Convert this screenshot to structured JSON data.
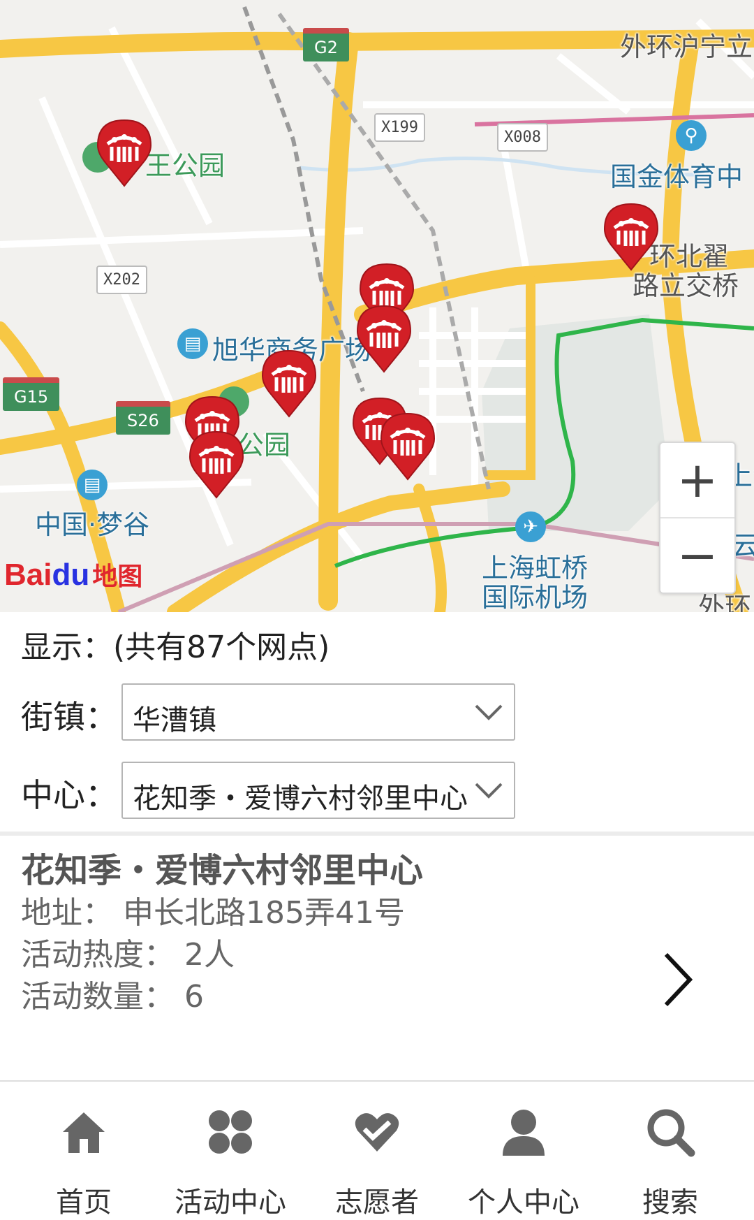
{
  "map": {
    "road_tags": {
      "g2": "G2",
      "x199": "X199",
      "x008": "X008",
      "x202": "X202",
      "g15": "G15",
      "s26": "S26"
    },
    "labels": {
      "park_top": "王公园",
      "outer_ring": "外环沪宁立",
      "sports_center": "国金体育中",
      "interchange_1": "环北翟",
      "interchange_2": "路立交桥",
      "xuhua_plaza": "旭华商务广场",
      "park_mid": "公园",
      "dream_valley": "中国·梦谷",
      "airport_1": "上海虹桥",
      "airport_2": "国际机场",
      "outer_ring_bottom": "外环",
      "right_edge_1": "上海",
      "right_edge_2": "云"
    },
    "zoom_in": "+",
    "zoom_out": "−",
    "logo": {
      "bai": "Bai",
      "du": "du",
      "ditu": "地图"
    },
    "marker_icon": "community-marker-icon"
  },
  "display_text": "显示：(共有87个网点)",
  "filters": {
    "street_label": "街镇：",
    "street_value": "华漕镇",
    "center_label": "中心：",
    "center_value": "花知季・爱博六村邻里中心"
  },
  "center": {
    "name": "花知季・爱博六村邻里中心",
    "address": "地址：  申长北路185弄41号",
    "heat": "活动热度：  2人",
    "count": "活动数量：  6"
  },
  "tabs": [
    {
      "label": "首页",
      "icon": "home-icon"
    },
    {
      "label": "活动中心",
      "icon": "activity-grid-icon"
    },
    {
      "label": "志愿者",
      "icon": "volunteer-heart-icon"
    },
    {
      "label": "个人中心",
      "icon": "user-icon"
    },
    {
      "label": "搜索",
      "icon": "search-icon"
    }
  ],
  "colors": {
    "road_major": "#f7c744",
    "marker_red": "#d21f26",
    "metro_green": "#2fb54a",
    "rail_pink": "#d9739f"
  }
}
